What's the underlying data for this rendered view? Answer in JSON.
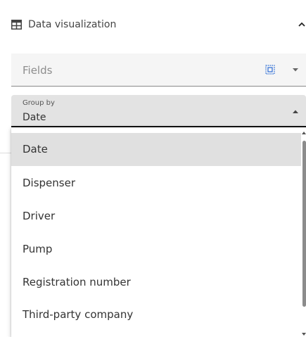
{
  "panel": {
    "title": "Data visualization",
    "icon": "table-icon",
    "collapse_icon": "chevron-up-icon"
  },
  "fields": {
    "placeholder": "Fields",
    "select_all_icon": "select-all-icon",
    "arrow_icon": "caret-down-icon"
  },
  "group_by": {
    "label": "Group by",
    "value": "Date",
    "arrow_icon": "caret-up-icon"
  },
  "dropdown": {
    "options": [
      {
        "label": "Date",
        "selected": true
      },
      {
        "label": "Dispenser",
        "selected": false
      },
      {
        "label": "Driver",
        "selected": false
      },
      {
        "label": "Pump",
        "selected": false
      },
      {
        "label": "Registration number",
        "selected": false
      },
      {
        "label": "Third-party company",
        "selected": false
      }
    ]
  },
  "colors": {
    "selected_bg": "#e0e0e0",
    "field_bg": "#f5f5f5",
    "select_icon_blue": "#2b6cd4"
  }
}
